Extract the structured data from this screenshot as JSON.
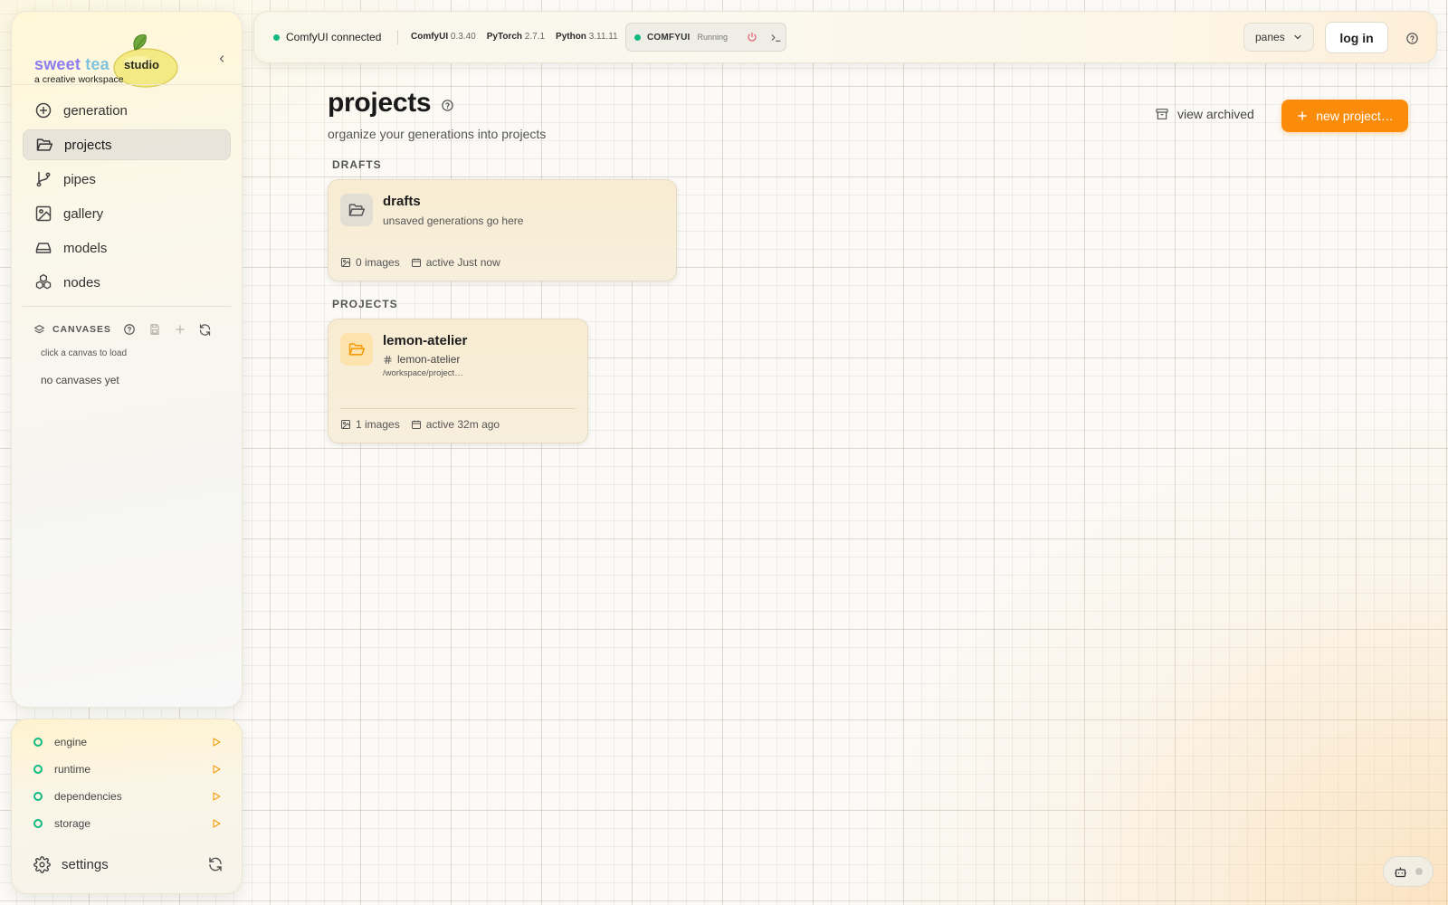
{
  "brand": {
    "word1": "sweet",
    "word2": "tea",
    "badge": "studio",
    "tagline": "a creative workspace"
  },
  "nav": {
    "items": [
      {
        "label": "generation",
        "icon": "plus-circle-icon"
      },
      {
        "label": "projects",
        "icon": "folder-open-icon",
        "active": true
      },
      {
        "label": "pipes",
        "icon": "git-branch-icon"
      },
      {
        "label": "gallery",
        "icon": "image-icon"
      },
      {
        "label": "models",
        "icon": "hard-drive-icon"
      },
      {
        "label": "nodes",
        "icon": "boxes-icon"
      }
    ]
  },
  "canvases": {
    "label": "CANVASES",
    "hint": "click a canvas to load",
    "empty": "no canvases yet"
  },
  "status": {
    "items": [
      {
        "label": "engine"
      },
      {
        "label": "runtime"
      },
      {
        "label": "dependencies"
      },
      {
        "label": "storage"
      }
    ],
    "settings_label": "settings"
  },
  "topbar": {
    "connection": "ComfyUI connected",
    "versions": [
      {
        "name": "ComfyUI",
        "version": "0.3.40"
      },
      {
        "name": "PyTorch",
        "version": "2.7.1"
      },
      {
        "name": "Python",
        "version": "3.11.11"
      }
    ],
    "comfy_name": "COMFYUI",
    "comfy_state": "Running",
    "panes_label": "panes",
    "login_label": "log in"
  },
  "main": {
    "title": "projects",
    "subtitle": "organize your generations into projects",
    "view_archived": "view archived",
    "new_project": "new project…",
    "drafts_section": "DRAFTS",
    "projects_section": "PROJECTS",
    "drafts_card": {
      "title": "drafts",
      "subtitle": "unsaved generations go here",
      "images": "0 images",
      "active": "active Just now"
    },
    "project_card": {
      "title": "lemon-atelier",
      "slug": "lemon-atelier",
      "path": "/workspace/project…",
      "images": "1 images",
      "active": "active 32m ago"
    }
  },
  "colors": {
    "accent": "#fb8c0a",
    "status_ok": "#10b981",
    "power_off": "#e35d6a"
  }
}
